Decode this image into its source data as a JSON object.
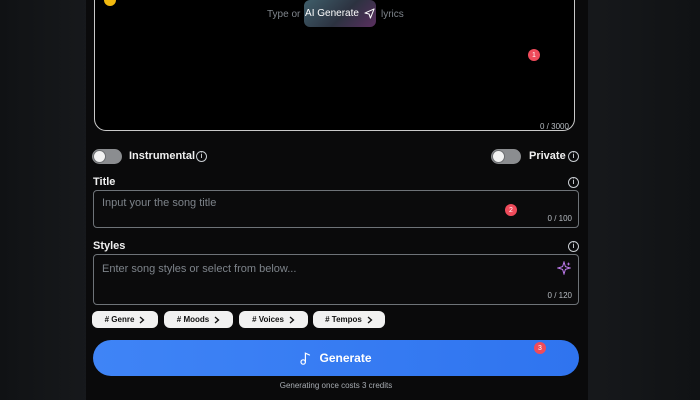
{
  "lyrics": {
    "hint_prefix": "Type or",
    "ai_button_label": "AI Generate",
    "hint_suffix": "lyrics",
    "counter": "0 / 3000"
  },
  "badges": [
    "1",
    "2",
    "3"
  ],
  "options": {
    "instrumental_label": "Instrumental",
    "instrumental_on": false,
    "private_label": "Private",
    "private_on": false
  },
  "title_field": {
    "label": "Title",
    "placeholder": "Input your the song title",
    "value": "",
    "counter": "0 / 100"
  },
  "styles_field": {
    "label": "Styles",
    "placeholder": "Enter song styles or select from below...",
    "value": "",
    "counter": "0 / 120"
  },
  "chips": [
    {
      "label": "# Genre"
    },
    {
      "label": "# Moods"
    },
    {
      "label": "# Voices"
    },
    {
      "label": "# Tempos"
    }
  ],
  "generate": {
    "label": "Generate",
    "cost_note": "Generating once costs 3 credits"
  },
  "colors": {
    "accent": "#3f84f6",
    "badge": "#ef4b5b",
    "background": "#0a0a0b"
  }
}
